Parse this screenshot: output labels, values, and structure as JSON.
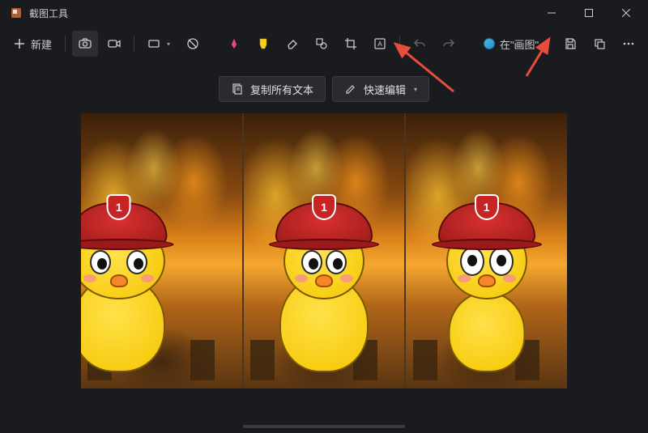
{
  "window": {
    "title": "截图工具"
  },
  "toolbar": {
    "new_label": "新建",
    "edit_in_label": "在\"画图\"..."
  },
  "secondary": {
    "copy_all_text": "复制所有文本",
    "quick_edit": "快速编辑"
  },
  "helmet_badges": [
    "1",
    "1",
    "1"
  ],
  "annotation_color": "#e74c3c"
}
